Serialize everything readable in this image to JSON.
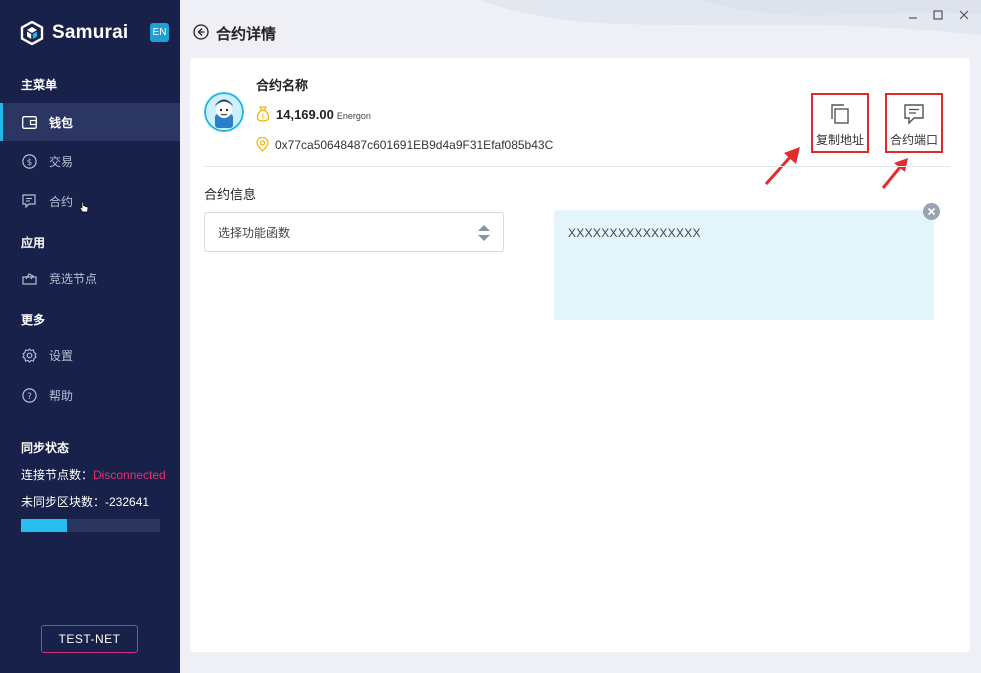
{
  "app": {
    "name": "Samurai",
    "lang": "EN"
  },
  "sidebar": {
    "main_menu_title": "主菜单",
    "items": [
      {
        "label": "钱包"
      },
      {
        "label": "交易"
      },
      {
        "label": "合约"
      }
    ],
    "apps_title": "应用",
    "app_items": [
      {
        "label": "竞选节点"
      }
    ],
    "more_title": "更多",
    "more_items": [
      {
        "label": "设置"
      },
      {
        "label": "帮助"
      }
    ],
    "sync": {
      "title": "同步状态",
      "nodes_label": "连接节点数：",
      "nodes_value": "Disconnected",
      "blocks_label": "未同步区块数：",
      "blocks_value": "-232641",
      "progress": 0.33
    },
    "network": "TEST-NET"
  },
  "header": {
    "title": "合约详情"
  },
  "contract": {
    "name": "合约名称",
    "balance": "14,169.00",
    "unit": "Energon",
    "address": "0x77ca50648487c601691EB9d4a9F31Efaf085b43C"
  },
  "actions": {
    "copy_label": "复制地址",
    "interface_label": "合约端口"
  },
  "info": {
    "title": "合约信息",
    "select_value": "选择功能函数",
    "output": "XXXXXXXXXXXXXXXX"
  },
  "colors": {
    "sidebar_bg": "#172149",
    "accent": "#1fb8e8",
    "danger": "#e8306f",
    "highlight_box": "#e02a2a"
  }
}
